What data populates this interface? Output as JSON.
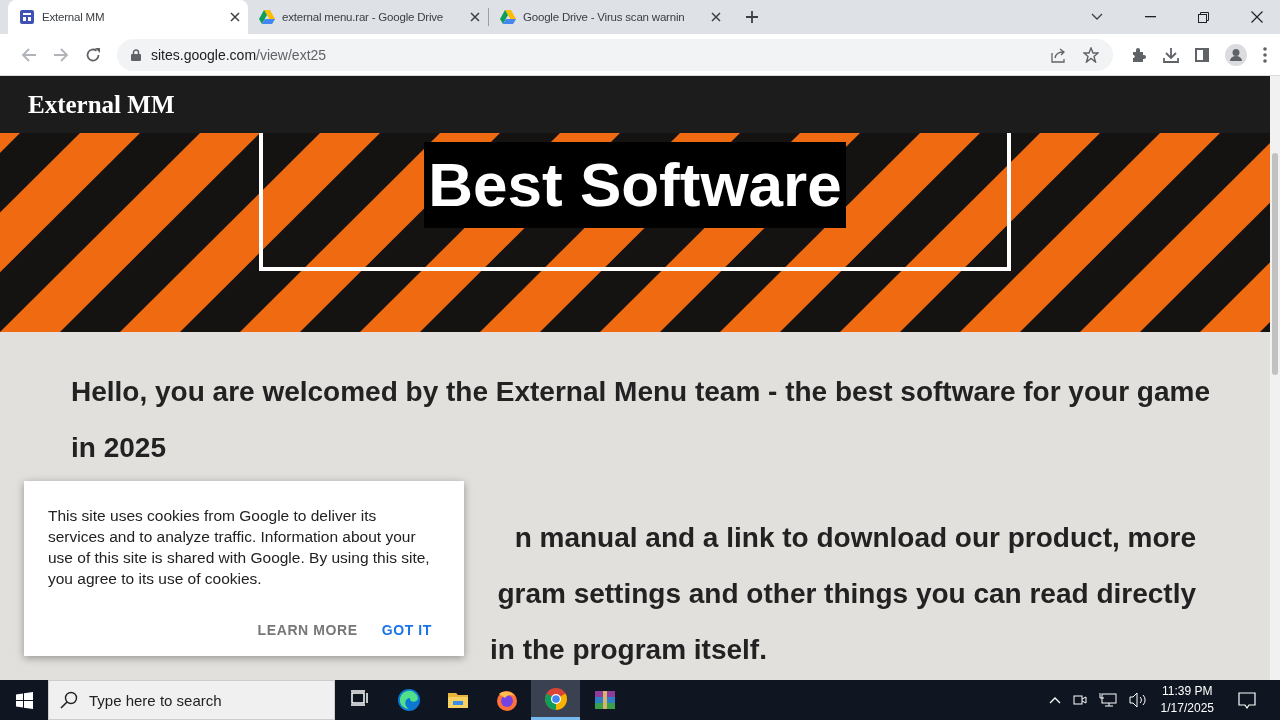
{
  "browser": {
    "tabs": [
      {
        "title": "External MM",
        "selected": true
      },
      {
        "title": "external menu.rar - Google Drive",
        "selected": false
      },
      {
        "title": "Google Drive - Virus scan warnin",
        "selected": false
      }
    ],
    "url_host": "sites.google.com",
    "url_path": "/view/ext25"
  },
  "page": {
    "site_title": "External MM",
    "hero_title": "Best Software",
    "paragraphs": [
      {
        "lines": [
          "Hello, you are welcomed by the External Menu team - the best software for your game in 2025"
        ]
      },
      {
        "lines": [
          "n manual and a link to download our product, more",
          "gram settings and other things you can read directly",
          "in the program itself."
        ]
      }
    ]
  },
  "cookie_notice": {
    "text": "This site uses cookies from Google to deliver its services and to analyze traffic. Information about your use of this site is shared with Google. By using this site, you agree to its use of cookies.",
    "buttons": [
      {
        "label": "LEARN MORE",
        "kind": "secondary"
      },
      {
        "label": "GOT IT",
        "kind": "primary"
      }
    ]
  },
  "taskbar": {
    "search_placeholder": "Type here to search",
    "apps": [
      {
        "selected": false
      },
      {
        "selected": false
      },
      {
        "selected": false
      },
      {
        "selected": false
      },
      {
        "selected": true
      },
      {
        "selected": false
      }
    ],
    "time": "11:39 PM",
    "date": "1/17/2025"
  }
}
